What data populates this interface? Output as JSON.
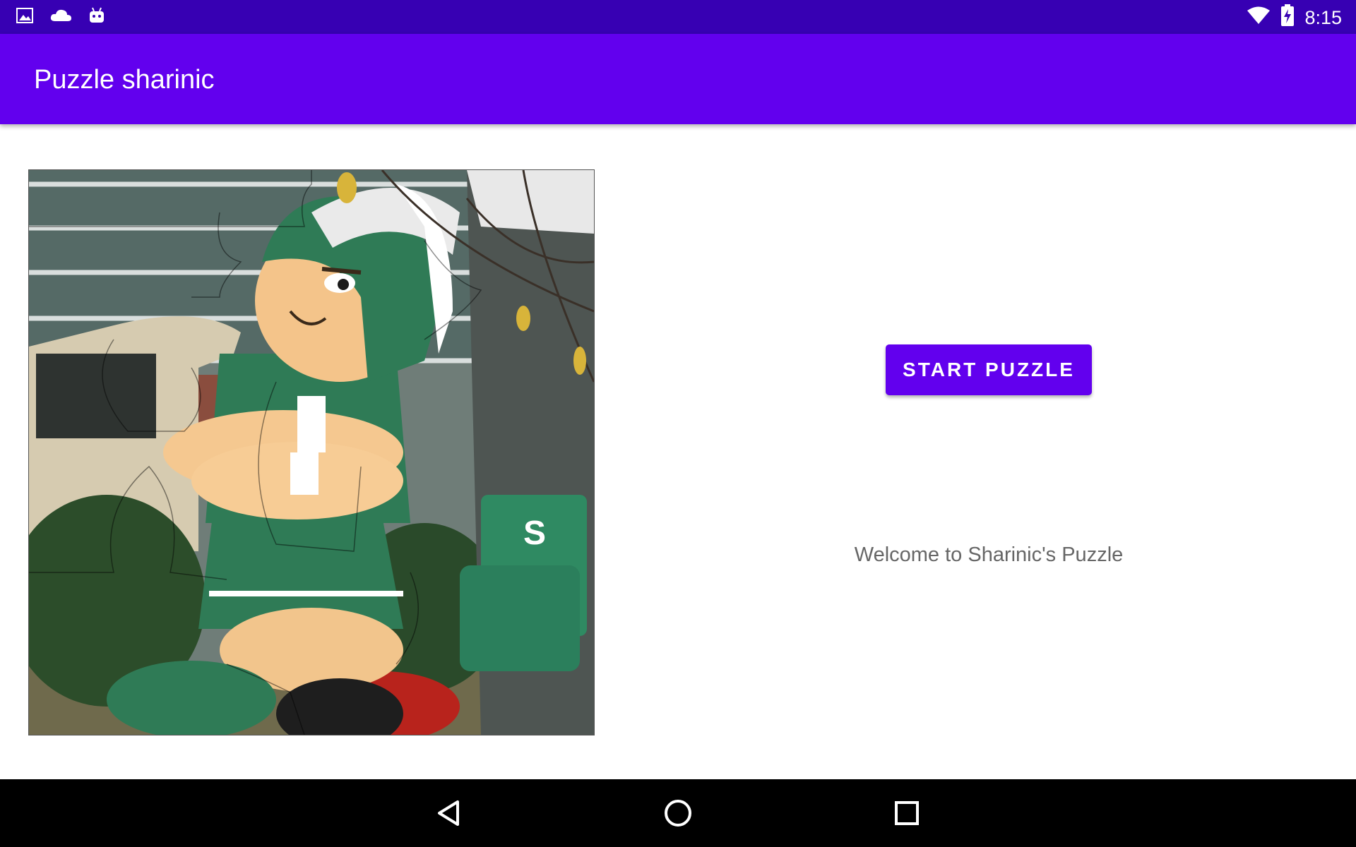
{
  "status_bar": {
    "time": "8:15",
    "left_icons": [
      "image-icon",
      "cloud-icon",
      "android-icon"
    ],
    "right_icons": [
      "wifi-icon",
      "battery-charging-icon"
    ]
  },
  "app_bar": {
    "title": "Puzzle sharinic"
  },
  "main": {
    "puzzle_image": {
      "description_icon": "puzzle-image"
    },
    "start_button_label": "START PUZZLE",
    "welcome_text": "Welcome to Sharinic's Puzzle"
  },
  "nav_bar": {
    "buttons": [
      "back-icon",
      "home-icon",
      "recents-icon"
    ]
  },
  "colors": {
    "status_bar": "#3700B3",
    "primary": "#6200EE",
    "nav_bar": "#000000",
    "secondary_text": "#666666"
  }
}
